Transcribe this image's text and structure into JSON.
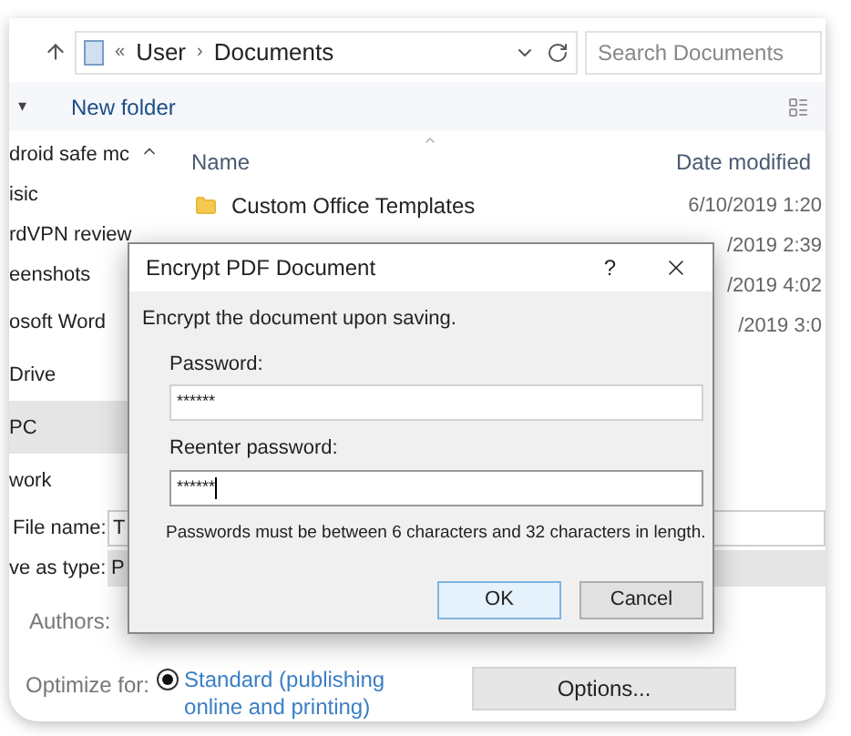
{
  "address_bar": {
    "overflow": "«",
    "separator": "›",
    "path": [
      "User",
      "Documents"
    ],
    "search_placeholder": "Search Documents"
  },
  "toolbar": {
    "menu_caret": "▾",
    "new_folder": "New folder"
  },
  "sidebar": {
    "items": [
      {
        "label": "droid safe mc",
        "selected": false
      },
      {
        "label": "isic",
        "selected": false
      },
      {
        "label": "rdVPN review",
        "selected": false
      },
      {
        "label": "eenshots",
        "selected": false
      },
      {
        "label": "osoft Word",
        "selected": false
      },
      {
        "label": "Drive",
        "selected": false
      },
      {
        "label": "PC",
        "selected": true
      },
      {
        "label": "work",
        "selected": false
      }
    ]
  },
  "file_list": {
    "columns": [
      "Name",
      "Date modified"
    ],
    "rows": [
      {
        "name": "Custom Office Templates",
        "kind": "folder",
        "date": "6/10/2019 1:20"
      },
      {
        "kind": "hidden",
        "date": "/2019 2:39"
      },
      {
        "kind": "hidden",
        "date": "/2019 4:02"
      },
      {
        "kind": "hidden",
        "date": "/2019 3:0"
      }
    ]
  },
  "save_form": {
    "file_name_label": "File name:",
    "file_name_value": "T",
    "type_label": "ve as type:",
    "type_value": "P",
    "authors_label": "Authors:",
    "optimize_label": "Optimize for:",
    "optimize_option": {
      "label": "Standard (publishing online and printing)",
      "selected": true
    },
    "options_button": "Options..."
  },
  "dialog": {
    "title": "Encrypt PDF Document",
    "help": "?",
    "intro": "Encrypt the document upon saving.",
    "fields": [
      {
        "label": "Password:",
        "value": "******",
        "focused": false
      },
      {
        "label": "Reenter password:",
        "value": "******",
        "focused": true
      }
    ],
    "note": "Passwords must be between 6 characters and 32 characters in length.",
    "buttons": [
      {
        "label": "OK",
        "default": true
      },
      {
        "label": "Cancel",
        "default": false
      }
    ]
  }
}
